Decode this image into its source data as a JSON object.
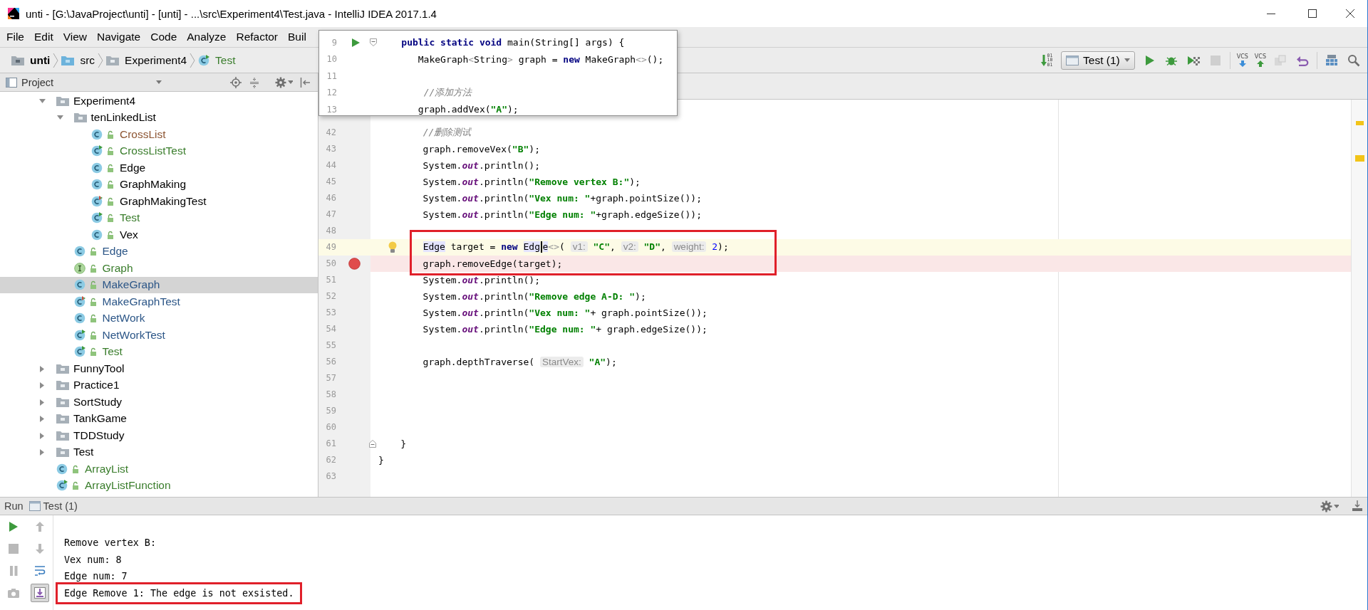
{
  "window": {
    "title": "unti - [G:\\JavaProject\\unti] - [unti] - ...\\src\\Experiment4\\Test.java - IntelliJ IDEA 2017.1.4"
  },
  "menu": [
    "File",
    "Edit",
    "View",
    "Navigate",
    "Code",
    "Analyze",
    "Refactor",
    "Buil"
  ],
  "navigation_bar": {
    "breadcrumbs": [
      {
        "label": "unti",
        "kind": "module"
      },
      {
        "label": "src",
        "kind": "source"
      },
      {
        "label": "Experiment4",
        "kind": "package"
      },
      {
        "label": "Test",
        "kind": "test_class"
      }
    ]
  },
  "toolbar": [
    {
      "kind": "make",
      "digits": [
        "01",
        "10",
        "01"
      ],
      "disabled": false
    },
    {
      "kind": "run_config",
      "label": "Test (1)",
      "disabled": false
    },
    {
      "kind": "run",
      "disabled": false
    },
    {
      "kind": "debug",
      "disabled": false
    },
    {
      "kind": "coverage",
      "disabled": false
    },
    {
      "kind": "stop",
      "disabled": true
    },
    {
      "kind": "vcs_update",
      "label": "VCS",
      "disabled": false
    },
    {
      "kind": "vcs_commit",
      "label": "VCS",
      "disabled": false
    },
    {
      "kind": "compare",
      "disabled": true
    },
    {
      "kind": "revert",
      "disabled": false
    },
    {
      "kind": "structure",
      "disabled": false
    },
    {
      "kind": "search",
      "disabled": false
    }
  ],
  "project": {
    "title": "Project",
    "tree": [
      {
        "label": "Experiment4",
        "kind": "folder",
        "color": "#000000",
        "expanded": true,
        "selected": false,
        "children": [
          {
            "label": "tenLinkedList",
            "kind": "folder",
            "color": "#000000",
            "expanded": true,
            "selected": false,
            "children": [
              {
                "label": "CrossList",
                "kind": "class",
                "color": "#8d5532",
                "selected": false
              },
              {
                "label": "CrossListTest",
                "kind": "test",
                "color": "#3a7d2c",
                "selected": false
              },
              {
                "label": "Edge",
                "kind": "class",
                "color": "#000000",
                "selected": false
              },
              {
                "label": "GraphMaking",
                "kind": "class",
                "color": "#000000",
                "selected": false
              },
              {
                "label": "GraphMakingTest",
                "kind": "test_mixed",
                "color": "#000000",
                "selected": false
              },
              {
                "label": "Test",
                "kind": "test",
                "color": "#3a7d2c",
                "selected": false
              },
              {
                "label": "Vex",
                "kind": "class",
                "color": "#000000",
                "selected": false
              }
            ]
          },
          {
            "label": "Edge",
            "kind": "class",
            "color": "#2c5687",
            "selected": false
          },
          {
            "label": "Graph",
            "kind": "interface",
            "color": "#3a7d2c",
            "selected": false
          },
          {
            "label": "MakeGraph",
            "kind": "class",
            "color": "#2c5687",
            "selected": true
          },
          {
            "label": "MakeGraphTest",
            "kind": "test_mixed",
            "color": "#2c5687",
            "selected": false
          },
          {
            "label": "NetWork",
            "kind": "class",
            "color": "#2c5687",
            "selected": false
          },
          {
            "label": "NetWorkTest",
            "kind": "test",
            "color": "#2c5687",
            "selected": false
          },
          {
            "label": "Test",
            "kind": "test",
            "color": "#3a7d2c",
            "selected": false
          }
        ]
      },
      {
        "label": "FunnyTool",
        "kind": "folder",
        "color": "#000000",
        "expanded": false,
        "selected": false
      },
      {
        "label": "Practice1",
        "kind": "folder",
        "color": "#000000",
        "expanded": false,
        "selected": false
      },
      {
        "label": "SortStudy",
        "kind": "folder",
        "color": "#000000",
        "expanded": false,
        "selected": false
      },
      {
        "label": "TankGame",
        "kind": "folder",
        "color": "#000000",
        "expanded": false,
        "selected": false
      },
      {
        "label": "TDDStudy",
        "kind": "folder",
        "color": "#000000",
        "expanded": false,
        "selected": false
      },
      {
        "label": "Test",
        "kind": "folder",
        "color": "#000000",
        "expanded": false,
        "selected": false
      },
      {
        "label": "ArrayList",
        "kind": "class",
        "color": "#3a7d2c",
        "selected": false
      },
      {
        "label": "ArrayListFunction",
        "kind": "test",
        "color": "#3a7d2c",
        "selected": false
      }
    ]
  },
  "editor": {
    "popup": {
      "lines": [
        {
          "number": "9",
          "runnable": true,
          "fold_start": true,
          "tokens": [
            {
              "text": "    public static void",
              "kind": "keyword"
            },
            {
              "text": " main(String[] args) {",
              "kind": "plain"
            }
          ]
        },
        {
          "number": "10",
          "tokens": [
            {
              "text": "       MakeGraph",
              "kind": "plain"
            },
            {
              "text": "<",
              "kind": "muted"
            },
            {
              "text": "String",
              "kind": "plain"
            },
            {
              "text": ">",
              "kind": "muted"
            },
            {
              "text": " graph = ",
              "kind": "plain"
            },
            {
              "text": "new",
              "kind": "keyword"
            },
            {
              "text": " MakeGraph",
              "kind": "plain"
            },
            {
              "text": "<>",
              "kind": "muted"
            },
            {
              "text": "();",
              "kind": "plain"
            }
          ]
        },
        {
          "number": "11"
        },
        {
          "number": "12",
          "tokens": [
            {
              "text": "        //添加方法",
              "kind": "comment"
            }
          ]
        },
        {
          "number": "13",
          "tokens": [
            {
              "text": "       graph.addVex(",
              "kind": "plain"
            },
            {
              "text": "\"A\"",
              "kind": "string"
            },
            {
              "text": ");",
              "kind": "plain"
            }
          ]
        }
      ]
    },
    "lines": [
      {
        "number": "42",
        "tokens": [
          {
            "text": "        //删除测试",
            "kind": "comment"
          }
        ]
      },
      {
        "number": "43",
        "tokens": [
          {
            "text": "        graph.removeVex(",
            "kind": "plain"
          },
          {
            "text": "\"B\"",
            "kind": "string"
          },
          {
            "text": ");",
            "kind": "plain"
          }
        ]
      },
      {
        "number": "44",
        "tokens": [
          {
            "text": "        System.",
            "kind": "plain"
          },
          {
            "text": "out",
            "kind": "field"
          },
          {
            "text": ".println();",
            "kind": "plain"
          }
        ]
      },
      {
        "number": "45",
        "tokens": [
          {
            "text": "        System.",
            "kind": "plain"
          },
          {
            "text": "out",
            "kind": "field"
          },
          {
            "text": ".println(",
            "kind": "plain"
          },
          {
            "text": "\"Remove vertex B:\"",
            "kind": "string"
          },
          {
            "text": ");",
            "kind": "plain"
          }
        ]
      },
      {
        "number": "46",
        "tokens": [
          {
            "text": "        System.",
            "kind": "plain"
          },
          {
            "text": "out",
            "kind": "field"
          },
          {
            "text": ".println(",
            "kind": "plain"
          },
          {
            "text": "\"Vex num: \"",
            "kind": "string"
          },
          {
            "text": "+graph.pointSize());",
            "kind": "plain"
          }
        ]
      },
      {
        "number": "47",
        "tokens": [
          {
            "text": "        System.",
            "kind": "plain"
          },
          {
            "text": "out",
            "kind": "field"
          },
          {
            "text": ".println(",
            "kind": "plain"
          },
          {
            "text": "\"Edge num: \"",
            "kind": "string"
          },
          {
            "text": "+graph.edgeSize());",
            "kind": "plain"
          }
        ]
      },
      {
        "number": "48"
      },
      {
        "number": "49",
        "current": true,
        "framed": true,
        "bulb": true,
        "tokens": [
          {
            "text": "        Edge",
            "kind": "usage"
          },
          {
            "text": " target = ",
            "kind": "plain"
          },
          {
            "text": "new",
            "kind": "keyword"
          },
          {
            "text": " Edg",
            "kind": "usage"
          },
          {
            "kind": "caret"
          },
          {
            "text": "e",
            "kind": "usage"
          },
          {
            "text": "<>",
            "kind": "muted"
          },
          {
            "text": "( ",
            "kind": "plain"
          },
          {
            "text": "v1:",
            "kind": "hint"
          },
          {
            "text": " \"C\"",
            "kind": "string"
          },
          {
            "text": ", ",
            "kind": "plain"
          },
          {
            "text": "v2:",
            "kind": "hint"
          },
          {
            "text": " \"D\"",
            "kind": "string"
          },
          {
            "text": ", ",
            "kind": "plain"
          },
          {
            "text": "weight:",
            "kind": "hint"
          },
          {
            "text": " 2",
            "kind": "number"
          },
          {
            "text": ");",
            "kind": "plain"
          }
        ]
      },
      {
        "number": "50",
        "breakpoint": true,
        "framed": true,
        "tokens": [
          {
            "text": "        graph.removeEdge(target);",
            "kind": "plain"
          }
        ]
      },
      {
        "number": "51",
        "tokens": [
          {
            "text": "        System.",
            "kind": "plain"
          },
          {
            "text": "out",
            "kind": "field"
          },
          {
            "text": ".println();",
            "kind": "plain"
          }
        ]
      },
      {
        "number": "52",
        "tokens": [
          {
            "text": "        System.",
            "kind": "plain"
          },
          {
            "text": "out",
            "kind": "field"
          },
          {
            "text": ".println(",
            "kind": "plain"
          },
          {
            "text": "\"Remove edge A-D: \"",
            "kind": "string"
          },
          {
            "text": ");",
            "kind": "plain"
          }
        ]
      },
      {
        "number": "53",
        "tokens": [
          {
            "text": "        System.",
            "kind": "plain"
          },
          {
            "text": "out",
            "kind": "field"
          },
          {
            "text": ".println(",
            "kind": "plain"
          },
          {
            "text": "\"Vex num: \"",
            "kind": "string"
          },
          {
            "text": "+ graph.pointSize());",
            "kind": "plain"
          }
        ]
      },
      {
        "number": "54",
        "tokens": [
          {
            "text": "        System.",
            "kind": "plain"
          },
          {
            "text": "out",
            "kind": "field"
          },
          {
            "text": ".println(",
            "kind": "plain"
          },
          {
            "text": "\"Edge num: \"",
            "kind": "string"
          },
          {
            "text": "+ graph.edgeSize());",
            "kind": "plain"
          }
        ]
      },
      {
        "number": "55"
      },
      {
        "number": "56",
        "tokens": [
          {
            "text": "        graph.depthTraverse( ",
            "kind": "plain"
          },
          {
            "text": "StartVex:",
            "kind": "hint"
          },
          {
            "text": " \"A\"",
            "kind": "string"
          },
          {
            "text": ");",
            "kind": "plain"
          }
        ]
      },
      {
        "number": "57"
      },
      {
        "number": "58"
      },
      {
        "number": "59"
      },
      {
        "number": "60"
      },
      {
        "number": "61",
        "fold_end": true,
        "tokens": [
          {
            "text": "    }",
            "kind": "plain"
          }
        ]
      },
      {
        "number": "62",
        "tokens": [
          {
            "text": "}",
            "kind": "plain"
          }
        ]
      },
      {
        "number": "63"
      }
    ]
  },
  "run_panel": {
    "label": "Run",
    "tab": "Test (1)",
    "toolbar": [
      {
        "kind": "rerun",
        "disabled": false
      },
      {
        "kind": "up",
        "disabled": true
      },
      {
        "kind": "stop",
        "disabled": true
      },
      {
        "kind": "down",
        "disabled": true
      },
      {
        "kind": "pause",
        "disabled": true
      },
      {
        "kind": "soft_wrap",
        "disabled": false,
        "toggled": false
      },
      {
        "kind": "camera",
        "disabled": true
      },
      {
        "kind": "scroll_end",
        "disabled": false,
        "toggled": true
      }
    ],
    "output": [
      {
        "text": "Remove vertex B:"
      },
      {
        "text": "Vex num: 8"
      },
      {
        "text": "Edge num: 7"
      },
      {
        "text": "Edge Remove 1: The edge is not exsisted.",
        "framed": true
      }
    ]
  }
}
